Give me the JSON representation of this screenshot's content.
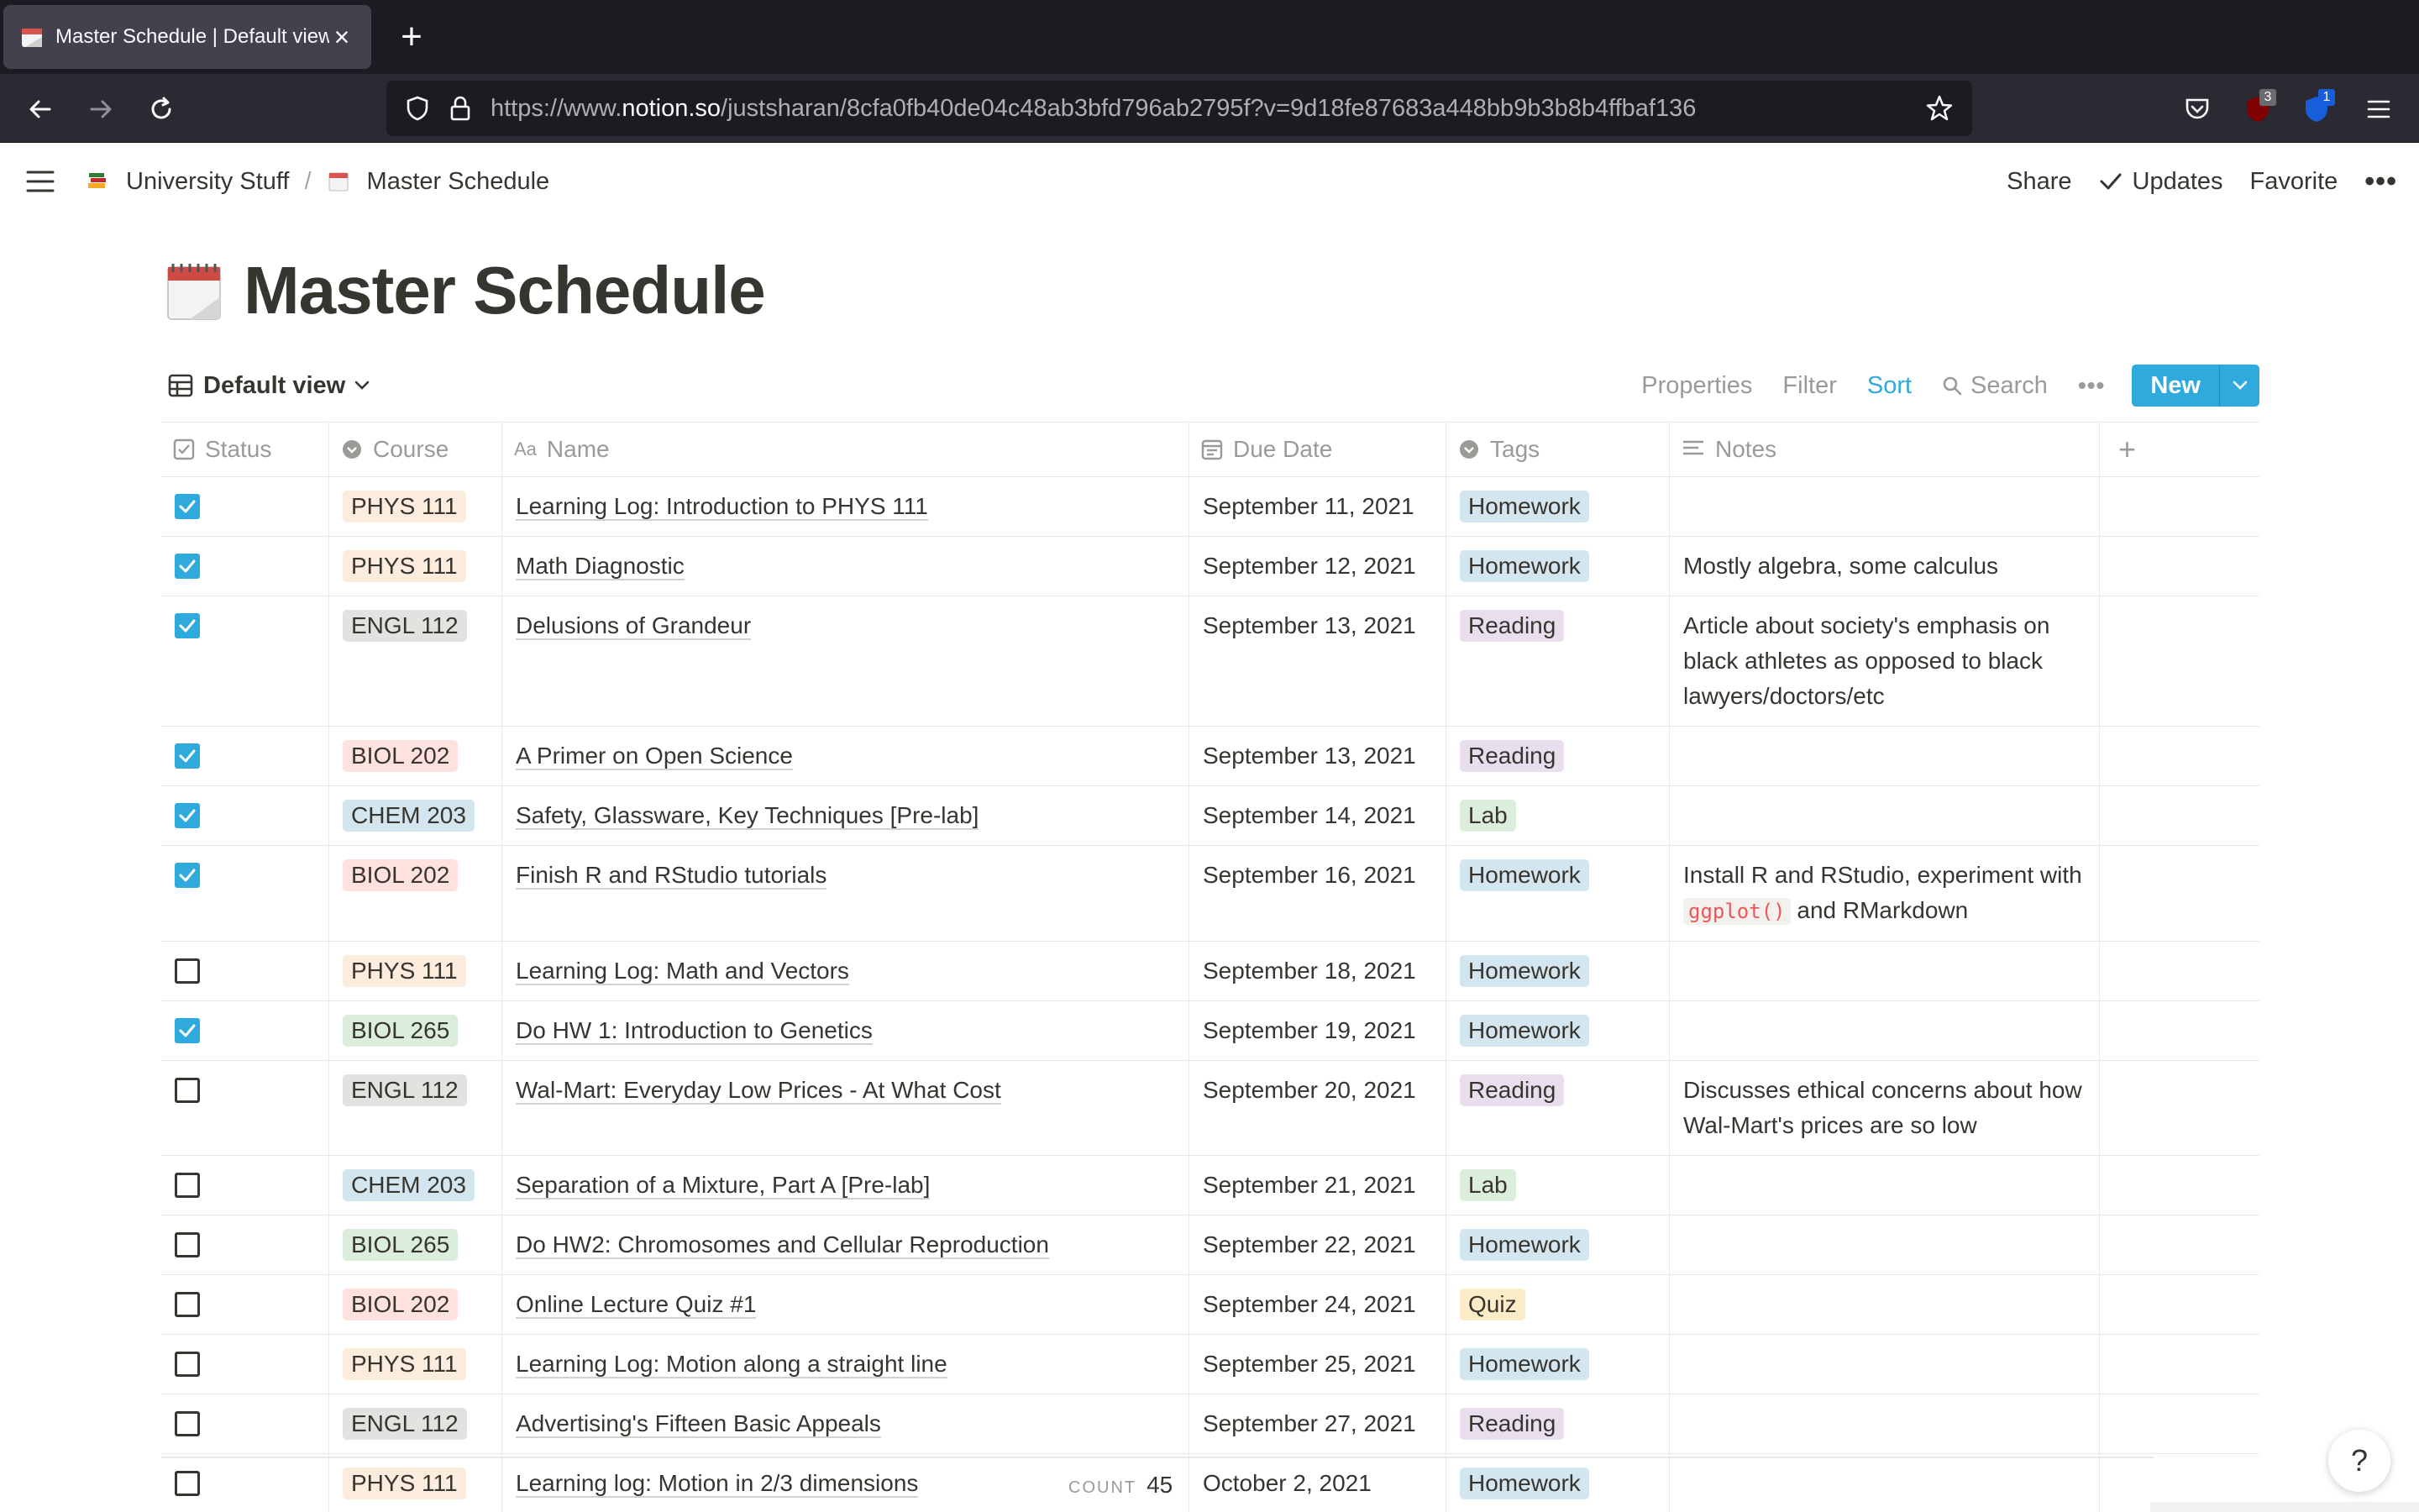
{
  "browser": {
    "tab_title": "Master Schedule | Default view",
    "url_prefix": "https://www.",
    "url_domain": "notion.so",
    "url_path": "/justsharan/8cfa0fb40de04c48ab3bfd796ab2795f?v=9d18fe87683a448bb9b3b8b4ffbaf136",
    "ext1_badge": "3",
    "ext2_badge": "1"
  },
  "topbar": {
    "crumb1": "University Stuff",
    "separator": "/",
    "crumb2": "Master Schedule",
    "share": "Share",
    "updates": "Updates",
    "favorite": "Favorite"
  },
  "page": {
    "title": "Master Schedule"
  },
  "view": {
    "name": "Default view",
    "properties": "Properties",
    "filter": "Filter",
    "sort": "Sort",
    "search": "Search",
    "new": "New"
  },
  "columns": {
    "status": "Status",
    "course": "Course",
    "name": "Name",
    "due": "Due Date",
    "tags": "Tags",
    "notes": "Notes"
  },
  "colors": {
    "accent": "#2eaadc",
    "PHYS 111": "#fbecdd",
    "ENGL 112": "#e3e2e0",
    "BIOL 202": "#ffe2dd",
    "CHEM 203": "#d3e5ef",
    "BIOL 265": "#dbeddb",
    "Homework": "#d3e5ef",
    "Reading": "#e8deee",
    "Lab": "#dbeddb",
    "Quiz": "#fdecc8"
  },
  "rows": [
    {
      "done": true,
      "course": "PHYS 111",
      "name": "Learning Log: Introduction to PHYS 111",
      "due": "September 11, 2021",
      "tag": "Homework",
      "notes": ""
    },
    {
      "done": true,
      "course": "PHYS 111",
      "name": "Math Diagnostic",
      "due": "September 12, 2021",
      "tag": "Homework",
      "notes": "Mostly algebra, some calculus"
    },
    {
      "done": true,
      "course": "ENGL 112",
      "name": "Delusions of Grandeur",
      "due": "September 13, 2021",
      "tag": "Reading",
      "notes": "Article about society's emphasis on black athletes as opposed to black lawyers/doctors/etc"
    },
    {
      "done": true,
      "course": "BIOL 202",
      "name": "A Primer on Open Science",
      "due": "September 13, 2021",
      "tag": "Reading",
      "notes": ""
    },
    {
      "done": true,
      "course": "CHEM 203",
      "name": "Safety, Glassware, Key Techniques [Pre-lab]",
      "due": "September 14, 2021",
      "tag": "Lab",
      "notes": ""
    },
    {
      "done": true,
      "course": "BIOL 202",
      "name": "Finish R and RStudio tutorials",
      "due": "September 16, 2021",
      "tag": "Homework",
      "notes": "Install R and RStudio, experiment with",
      "notes_code": "ggplot()",
      "notes_after": " and RMarkdown"
    },
    {
      "done": false,
      "course": "PHYS 111",
      "name": "Learning Log: Math and Vectors",
      "due": "September 18, 2021",
      "tag": "Homework",
      "notes": ""
    },
    {
      "done": true,
      "course": "BIOL 265",
      "name": "Do HW 1: Introduction to Genetics",
      "due": "September 19, 2021",
      "tag": "Homework",
      "notes": ""
    },
    {
      "done": false,
      "course": "ENGL 112",
      "name": "Wal-Mart: Everyday Low Prices - At What Cost",
      "due": "September 20, 2021",
      "tag": "Reading",
      "notes": "Discusses ethical concerns about how Wal-Mart's prices are so low"
    },
    {
      "done": false,
      "course": "CHEM 203",
      "name": "Separation of a Mixture, Part A [Pre-lab]",
      "due": "September 21, 2021",
      "tag": "Lab",
      "notes": ""
    },
    {
      "done": false,
      "course": "BIOL 265",
      "name": "Do HW2: Chromosomes and Cellular Reproduction",
      "due": "September 22, 2021",
      "tag": "Homework",
      "notes": ""
    },
    {
      "done": false,
      "course": "BIOL 202",
      "name": "Online Lecture Quiz #1",
      "due": "September 24, 2021",
      "tag": "Quiz",
      "notes": ""
    },
    {
      "done": false,
      "course": "PHYS 111",
      "name": "Learning Log: Motion along a straight line",
      "due": "September 25, 2021",
      "tag": "Homework",
      "notes": ""
    },
    {
      "done": false,
      "course": "ENGL 112",
      "name": "Advertising's Fifteen Basic Appeals",
      "due": "September 27, 2021",
      "tag": "Reading",
      "notes": ""
    },
    {
      "done": false,
      "course": "PHYS 111",
      "name": "Learning log: Motion in 2/3 dimensions",
      "due": "October 2, 2021",
      "tag": "Homework",
      "notes": ""
    }
  ],
  "footer": {
    "count_label": "COUNT",
    "count_value": "45"
  },
  "help": "?"
}
